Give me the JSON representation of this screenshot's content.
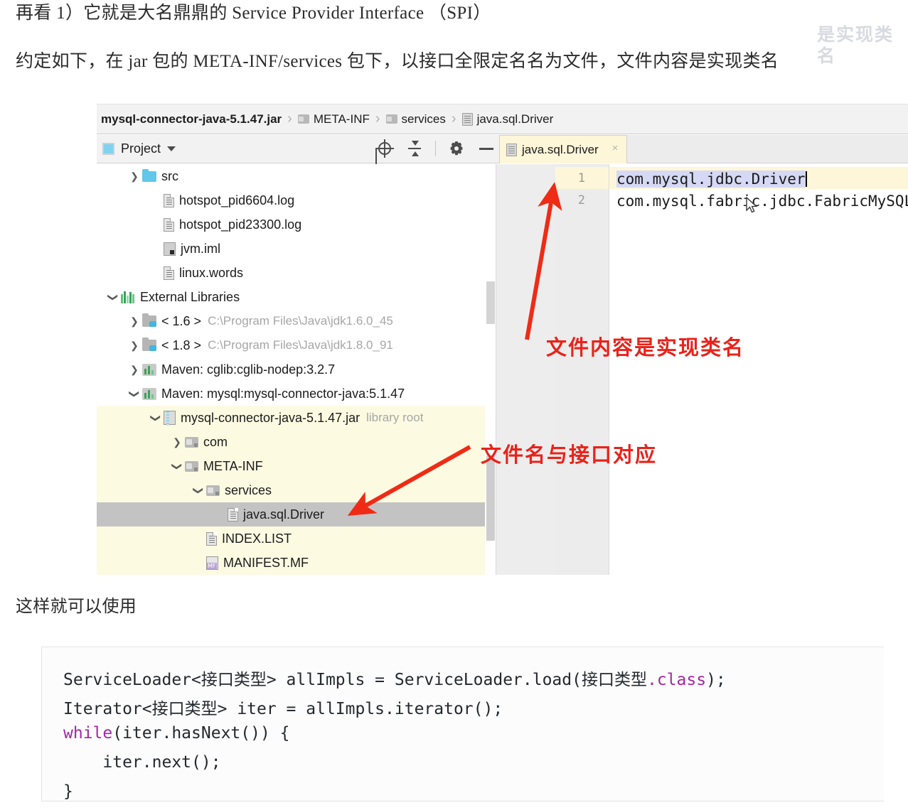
{
  "doc": {
    "line1": "再看 1）它就是大名鼎鼎的 Service Provider Interface （SPI）",
    "line2": "约定如下，在 jar 包的 META-INF/services 包下，以接口全限定名名为文件，文件内容是实现类名",
    "line3": "这样就可以使用",
    "watermark": "是实现类名"
  },
  "ide": {
    "breadcrumb": [
      {
        "label": "mysql-connector-java-5.1.47.jar",
        "icon": "none",
        "bold": true
      },
      {
        "label": "META-INF",
        "icon": "folder-icon",
        "bold": false
      },
      {
        "label": "services",
        "icon": "folder-icon",
        "bold": false
      },
      {
        "label": "java.sql.Driver",
        "icon": "file-icon",
        "bold": false
      }
    ],
    "separator": "›",
    "toolbar": {
      "panel_title": "Project",
      "icons": [
        "locate-target-icon",
        "collapse-all-icon",
        "settings-gear-icon",
        "hide-minimize-icon"
      ]
    },
    "editor_tab": {
      "label": "java.sql.Driver",
      "close": "×"
    },
    "tree": [
      {
        "indent": 1,
        "arrow": "right",
        "icon": "src-folder-icon",
        "label": "src",
        "dim": "",
        "state": "normal"
      },
      {
        "indent": 2,
        "arrow": "none",
        "icon": "text-file-icon",
        "label": "hotspot_pid6604.log",
        "dim": "",
        "state": "normal"
      },
      {
        "indent": 2,
        "arrow": "none",
        "icon": "text-file-icon",
        "label": "hotspot_pid23300.log",
        "dim": "",
        "state": "normal"
      },
      {
        "indent": 2,
        "arrow": "none",
        "icon": "iml-file-icon",
        "label": "jvm.iml",
        "dim": "",
        "state": "normal"
      },
      {
        "indent": 2,
        "arrow": "none",
        "icon": "text-file-icon",
        "label": "linux.words",
        "dim": "",
        "state": "normal"
      },
      {
        "indent": 0,
        "arrow": "down",
        "icon": "external-libraries-icon",
        "label": "External Libraries",
        "dim": "",
        "state": "normal"
      },
      {
        "indent": 1,
        "arrow": "right",
        "icon": "jdk-icon",
        "label": "< 1.6 >",
        "dim": "C:\\Program Files\\Java\\jdk1.6.0_45",
        "state": "normal"
      },
      {
        "indent": 1,
        "arrow": "right",
        "icon": "jdk-icon",
        "label": "< 1.8 >",
        "dim": "C:\\Program Files\\Java\\jdk1.8.0_91",
        "state": "normal"
      },
      {
        "indent": 1,
        "arrow": "right",
        "icon": "maven-icon",
        "label": "Maven: cglib:cglib-nodep:3.2.7",
        "dim": "",
        "state": "normal"
      },
      {
        "indent": 1,
        "arrow": "down",
        "icon": "maven-icon",
        "label": "Maven: mysql:mysql-connector-java:5.1.47",
        "dim": "",
        "state": "normal"
      },
      {
        "indent": 2,
        "arrow": "down",
        "icon": "jar-icon",
        "label": "mysql-connector-java-5.1.47.jar",
        "dim": "library root",
        "state": "highlight"
      },
      {
        "indent": 3,
        "arrow": "right",
        "icon": "package-icon",
        "label": "com",
        "dim": "",
        "state": "highlight"
      },
      {
        "indent": 3,
        "arrow": "down",
        "icon": "package-icon",
        "label": "META-INF",
        "dim": "",
        "state": "highlight"
      },
      {
        "indent": 4,
        "arrow": "down",
        "icon": "package-icon",
        "label": "services",
        "dim": "",
        "state": "highlight"
      },
      {
        "indent": 5,
        "arrow": "none",
        "icon": "text-file-icon",
        "label": "java.sql.Driver",
        "dim": "",
        "state": "selected"
      },
      {
        "indent": 4,
        "arrow": "none",
        "icon": "text-file-icon",
        "label": "INDEX.LIST",
        "dim": "",
        "state": "highlight"
      },
      {
        "indent": 4,
        "arrow": "none",
        "icon": "manifest-file-icon",
        "label": "MANIFEST.MF",
        "dim": "",
        "state": "highlight"
      }
    ],
    "code": {
      "line_numbers": [
        "1",
        "2"
      ],
      "line1": "com.mysql.jdbc.Driver",
      "line2": "com.mysql.fabric.jdbc.FabricMySQLDriver"
    },
    "annotations": [
      {
        "text": "文件内容是实现类名",
        "color": "#e8231a"
      },
      {
        "text": "文件名与接口对应",
        "color": "#e8231a"
      }
    ]
  },
  "code_sample": {
    "lines": [
      [
        {
          "t": "ServiceLoader<接口类型> allImpls = ServiceLoader.load(接口类型",
          "c": "plain"
        },
        {
          "t": ".class",
          "c": "kw"
        },
        {
          "t": ");",
          "c": "plain"
        }
      ],
      [
        {
          "t": "Iterator<接口类型> iter = allImpls.iterator();",
          "c": "plain"
        }
      ],
      [
        {
          "t": "while",
          "c": "kw"
        },
        {
          "t": "(iter.hasNext()) {",
          "c": "plain"
        }
      ],
      [
        {
          "t": "    iter.next();",
          "c": "plain"
        }
      ],
      [
        {
          "t": "}",
          "c": "plain"
        }
      ]
    ]
  },
  "colors": {
    "annotation_red": "#e8231a",
    "tree_highlight": "#fcfae1",
    "tree_selection": "#c3c3c3",
    "tab_active": "#fdf6d8",
    "code_keyword": "#a626a4",
    "selection_blue": "#d6d9f5"
  }
}
